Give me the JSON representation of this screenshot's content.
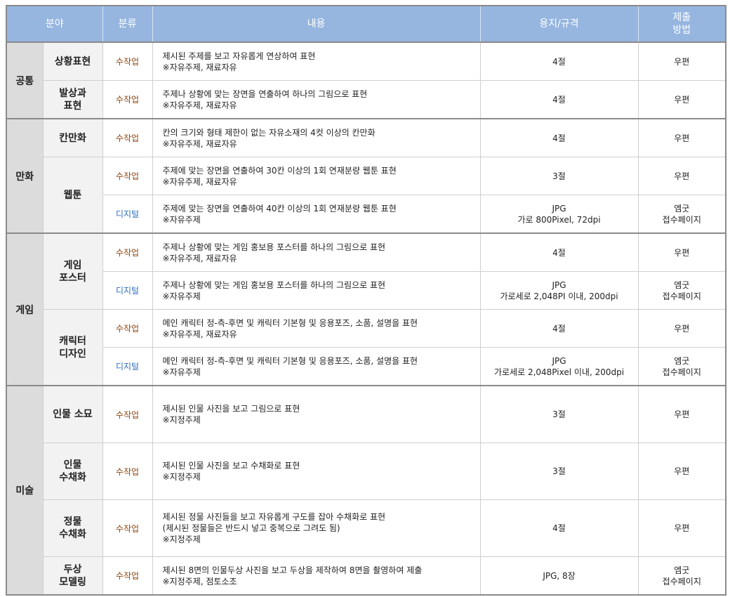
{
  "header": {
    "field": "분야",
    "type": "분류",
    "content": "내용",
    "paper": "용지/규격",
    "submit_1": "제출",
    "submit_2": "방법"
  },
  "groups": [
    {
      "field": "공통",
      "rows": [
        {
          "sub": [
            "상황표현"
          ],
          "type": "수작업",
          "kind": "hand",
          "content": [
            "제시된 주제를 보고 자유롭게 연상하여 표현",
            "※자유주제, 재료자유"
          ],
          "paper": [
            "4절"
          ],
          "submit": [
            "우편"
          ]
        },
        {
          "sub": [
            "발상과",
            "표현"
          ],
          "type": "수작업",
          "kind": "hand",
          "content": [
            "주제나 상황에 맞는 장면을 연출하여 하나의 그림으로 표현",
            "※자유주제, 재료자유"
          ],
          "paper": [
            "4절"
          ],
          "submit": [
            "우편"
          ]
        }
      ]
    },
    {
      "field": "만화",
      "rows": [
        {
          "sub": [
            "칸만화"
          ],
          "type": "수작업",
          "kind": "hand",
          "content": [
            "칸의 크기와 형태 제한이 없는 자유소재의 4컷 이상의 칸만화",
            "※자유주제, 재료자유"
          ],
          "paper": [
            "4절"
          ],
          "submit": [
            "우편"
          ]
        },
        {
          "sub": [
            "웹툰"
          ],
          "subspan": 2,
          "type": "수작업",
          "kind": "hand",
          "content": [
            "주제에 맞는 장면을 연출하여 30칸 이상의 1회 연재분량 웹툰 표현",
            "※자유주제, 재료자유"
          ],
          "paper": [
            "3절"
          ],
          "submit": [
            "우편"
          ]
        },
        {
          "type": "디지털",
          "kind": "digital",
          "content": [
            "주제에 맞는 장면을 연출하여 40칸 이상의 1회 연재분량 웹툰 표현",
            "※자유주제"
          ],
          "paper": [
            "JPG",
            "가로 800Pixel, 72dpi"
          ],
          "submit": [
            "엠굿",
            "접수페이지"
          ]
        }
      ]
    },
    {
      "field": "게임",
      "rows": [
        {
          "sub": [
            "게임",
            "포스터"
          ],
          "subspan": 2,
          "type": "수작업",
          "kind": "hand",
          "content": [
            "주제나 상황에 맞는 게임 홍보용 포스터를 하나의 그림으로 표현",
            "※자유주제, 재료자유"
          ],
          "paper": [
            "4절"
          ],
          "submit": [
            "우편"
          ]
        },
        {
          "type": "디지털",
          "kind": "digital",
          "content": [
            "주제나 상황에 맞는 게임 홍보용 포스터를 하나의 그림으로 표현",
            "※자유주제"
          ],
          "paper": [
            "JPG",
            "가로세로 2,048PI 이내, 200dpi"
          ],
          "submit": [
            "엠굿",
            "접수페이지"
          ]
        },
        {
          "sub": [
            "캐릭터",
            "디자인"
          ],
          "subspan": 2,
          "type": "수작업",
          "kind": "hand",
          "content": [
            "메인 캐릭터 정-측-후면 및 캐릭터 기본형 및 응용포즈, 소품, 설명을 표현",
            "※자유주제, 재료자유"
          ],
          "paper": [
            "4절"
          ],
          "submit": [
            "우편"
          ]
        },
        {
          "type": "디지털",
          "kind": "digital",
          "content": [
            "메인 캐릭터 정-측-후면 및 캐릭터 기본형 및 응용포즈, 소품, 설명을 표현",
            "※자유주제"
          ],
          "paper": [
            "JPG",
            "가로세로 2,048Pixel 이내, 200dpi"
          ],
          "submit": [
            "엠굿",
            "접수페이지"
          ]
        }
      ]
    },
    {
      "field": "미술",
      "tall": true,
      "rows": [
        {
          "sub": [
            "인물 소묘"
          ],
          "type": "수작업",
          "kind": "hand",
          "content": [
            "제시된 인물 사진을 보고 그림으로 표현",
            "※지정주제"
          ],
          "paper": [
            "3절"
          ],
          "submit": [
            "우편"
          ]
        },
        {
          "sub": [
            "인물",
            "수채화"
          ],
          "type": "수작업",
          "kind": "hand",
          "content": [
            "제시된 인물 사진을 보고 수채화로 표현",
            "※지정주제"
          ],
          "paper": [
            "3절"
          ],
          "submit": [
            "우편"
          ]
        },
        {
          "sub": [
            "정물",
            "수채화"
          ],
          "type": "수작업",
          "kind": "hand",
          "content": [
            "제시된 정물 사진들을 보고 자유롭게 구도를 잡아 수채화로 표현",
            "(제시된 정물들은 반드시 넣고 중복으로 그려도 됨)",
            "※지정주제"
          ],
          "paper": [
            "4절"
          ],
          "submit": [
            "우편"
          ]
        },
        {
          "sub": [
            "두상",
            "모델링"
          ],
          "short": true,
          "type": "수작업",
          "kind": "hand",
          "content": [
            "제시된 8면의 인물두상 사진을 보고 두상을 제작하여 8면을 촬영하여 제출",
            "※지정주제, 점토소조"
          ],
          "paper": [
            "JPG, 8장"
          ],
          "submit": [
            "엠굿",
            "접수페이지"
          ]
        }
      ]
    }
  ]
}
